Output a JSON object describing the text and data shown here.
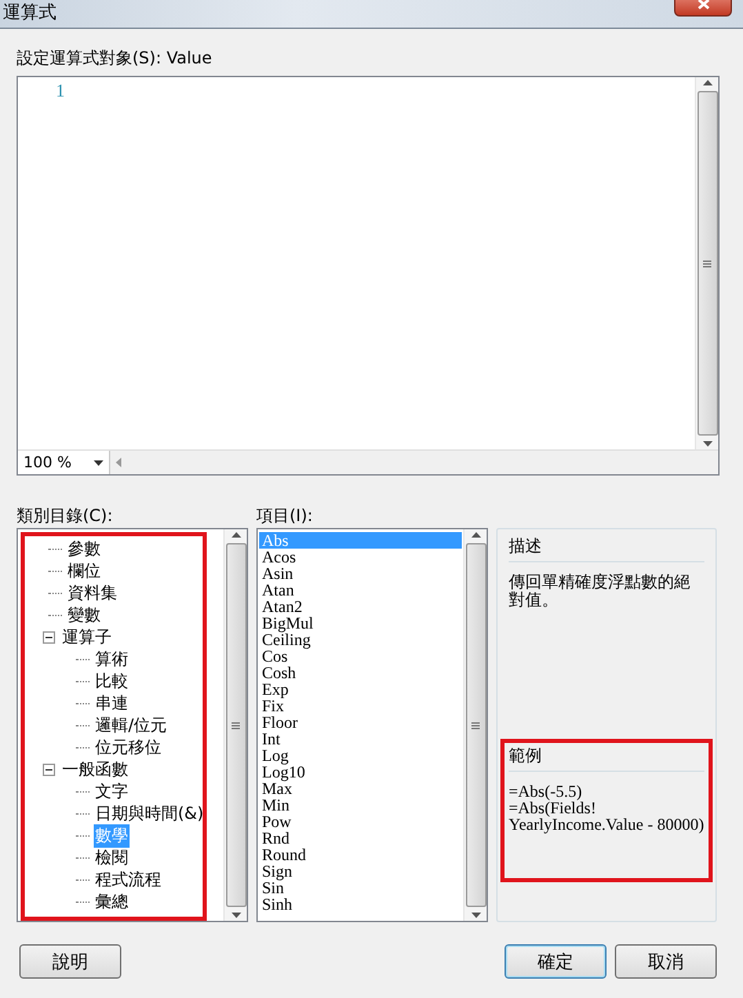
{
  "window": {
    "title": "運算式"
  },
  "expression_label": "設定運算式對象(S): Value",
  "editor": {
    "line_numbers": [
      "1"
    ],
    "zoom": "100 %"
  },
  "category_label": "類別目錄(C):",
  "categories": {
    "highlighted": true,
    "items": [
      {
        "label": "參數",
        "selected": false
      },
      {
        "label": "欄位",
        "selected": false
      },
      {
        "label": "資料集",
        "selected": false
      },
      {
        "label": "變數",
        "selected": false
      },
      {
        "label": "運算子",
        "selected": false,
        "expanded": true,
        "children": [
          {
            "label": "算術",
            "selected": false
          },
          {
            "label": "比較",
            "selected": false
          },
          {
            "label": "串連",
            "selected": false
          },
          {
            "label": "邏輯/位元",
            "selected": false
          },
          {
            "label": "位元移位",
            "selected": false
          }
        ]
      },
      {
        "label": "一般函數",
        "selected": false,
        "expanded": true,
        "children": [
          {
            "label": "文字",
            "selected": false
          },
          {
            "label": "日期與時間(&)",
            "selected": false
          },
          {
            "label": "數學",
            "selected": true
          },
          {
            "label": "檢閱",
            "selected": false
          },
          {
            "label": "程式流程",
            "selected": false
          },
          {
            "label": "彙總",
            "selected": false
          }
        ]
      }
    ]
  },
  "items_label": "項目(I):",
  "items": [
    {
      "label": "Abs",
      "selected": true
    },
    {
      "label": "Acos",
      "selected": false
    },
    {
      "label": "Asin",
      "selected": false
    },
    {
      "label": "Atan",
      "selected": false
    },
    {
      "label": "Atan2",
      "selected": false
    },
    {
      "label": "BigMul",
      "selected": false
    },
    {
      "label": "Ceiling",
      "selected": false
    },
    {
      "label": "Cos",
      "selected": false
    },
    {
      "label": "Cosh",
      "selected": false
    },
    {
      "label": "Exp",
      "selected": false
    },
    {
      "label": "Fix",
      "selected": false
    },
    {
      "label": "Floor",
      "selected": false
    },
    {
      "label": "Int",
      "selected": false
    },
    {
      "label": "Log",
      "selected": false
    },
    {
      "label": "Log10",
      "selected": false
    },
    {
      "label": "Max",
      "selected": false
    },
    {
      "label": "Min",
      "selected": false
    },
    {
      "label": "Pow",
      "selected": false
    },
    {
      "label": "Rnd",
      "selected": false
    },
    {
      "label": "Round",
      "selected": false
    },
    {
      "label": "Sign",
      "selected": false
    },
    {
      "label": "Sin",
      "selected": false
    },
    {
      "label": "Sinh",
      "selected": false
    }
  ],
  "description": {
    "title": "描述",
    "text": "傳回單精確度浮點數的絕對值。"
  },
  "example": {
    "title": "範例",
    "highlighted": true,
    "lines": [
      "=Abs(-5.5)",
      "=Abs(Fields!",
      "YearlyIncome.Value - 80000)"
    ]
  },
  "buttons": [
    {
      "label": "說明",
      "kind": "help"
    },
    {
      "label": "確定",
      "kind": "default"
    },
    {
      "label": "取消",
      "kind": "normal"
    }
  ]
}
